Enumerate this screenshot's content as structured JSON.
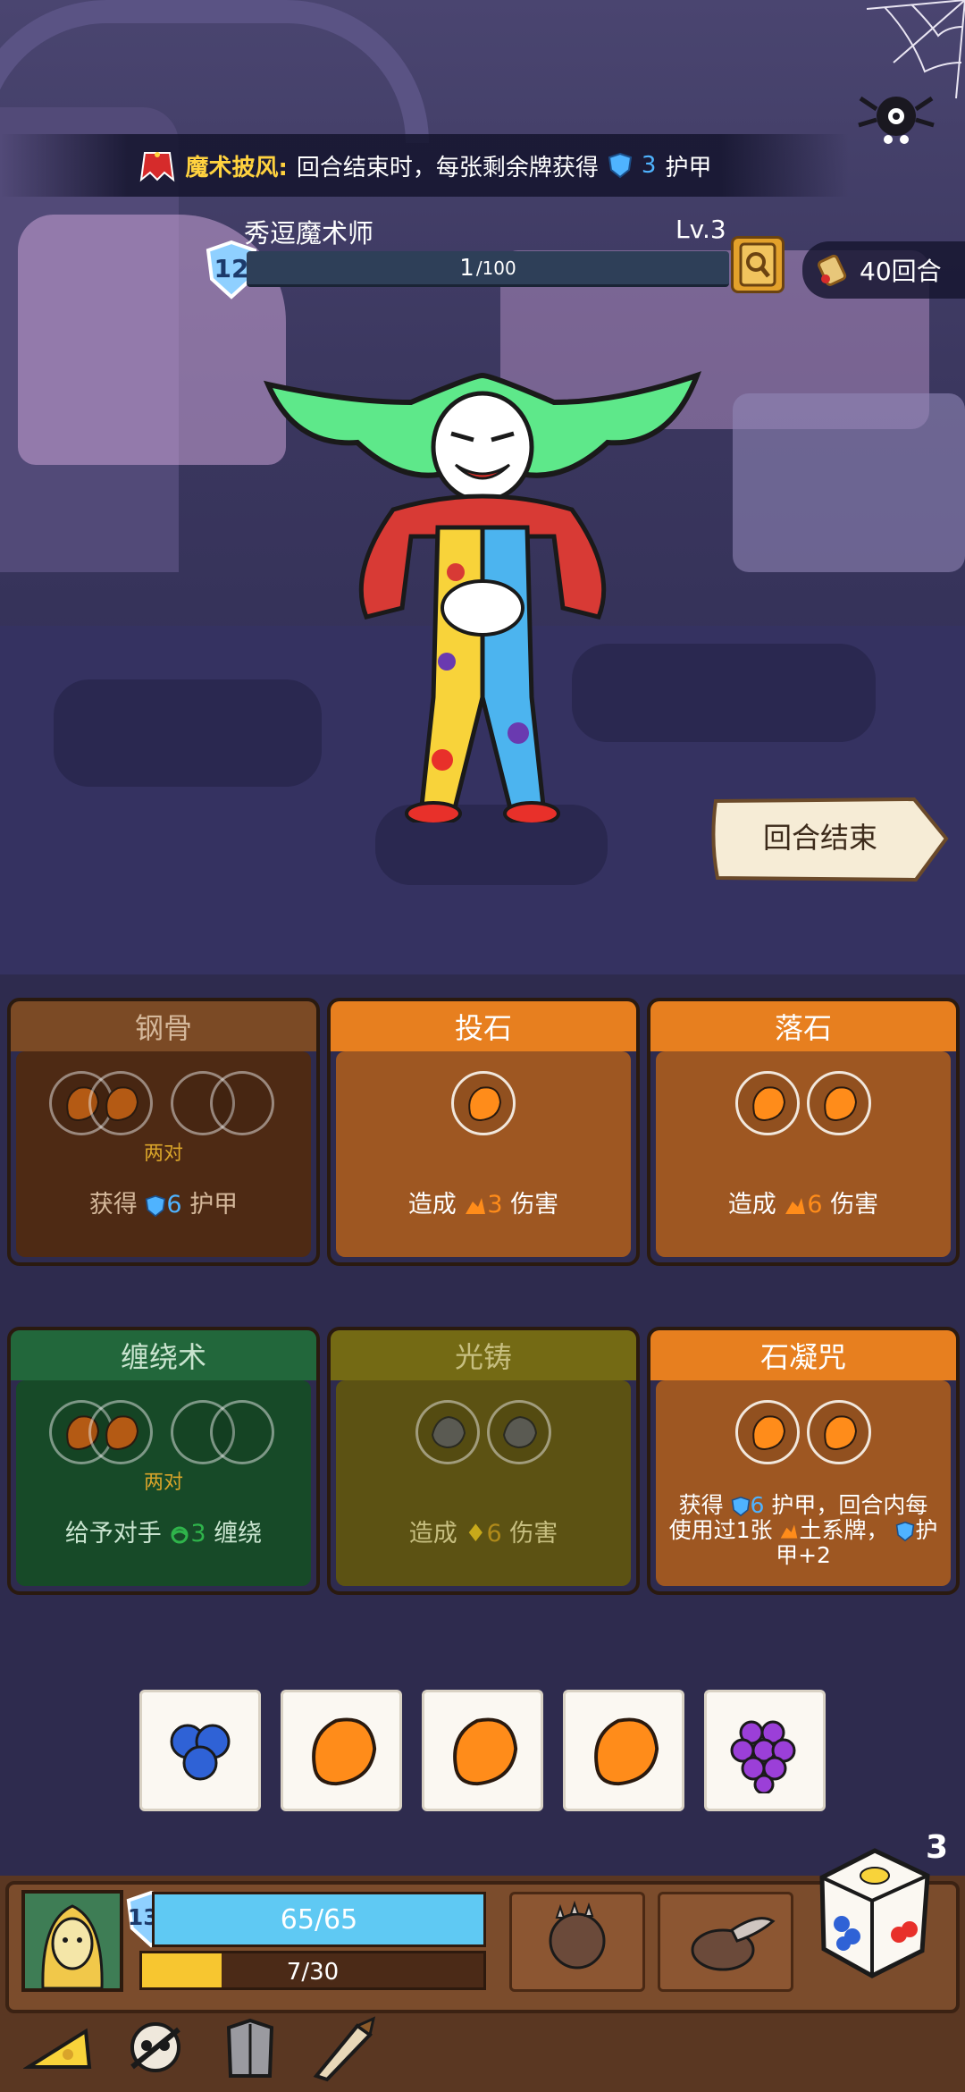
{
  "relic": {
    "name": "魔术披风:",
    "desc_before": "回合结束时，每张剩余牌获得",
    "value": "3",
    "desc_after": "护甲"
  },
  "enemy": {
    "name": "秀逗魔术师",
    "level": "Lv.3",
    "shield": "12",
    "hp_current": "1",
    "hp_max": "/100"
  },
  "round": {
    "label": "40回合"
  },
  "end_turn": {
    "label": "回合结束"
  },
  "cards": [
    {
      "title": "钢骨",
      "pair": "两对",
      "effect_prefix": "获得",
      "value": "6",
      "effect_suffix": "护甲"
    },
    {
      "title": "投石",
      "effect_prefix": "造成",
      "value": "3",
      "effect_suffix": "伤害"
    },
    {
      "title": "落石",
      "effect_prefix": "造成",
      "value": "6",
      "effect_suffix": "伤害"
    },
    {
      "title": "缠绕术",
      "pair": "两对",
      "effect_prefix": "给予对手",
      "value": "3",
      "effect_suffix": "缠绕"
    },
    {
      "title": "光铸",
      "effect_prefix": "造成",
      "value": "6",
      "effect_suffix": "伤害"
    },
    {
      "title": "石凝咒",
      "effect_line1_prefix": "获得",
      "value": "6",
      "effect_line1_suffix": "护甲，回合内每",
      "effect_line2_prefix": "使用过1张",
      "effect_line2_suffix": "土系牌，",
      "effect_line3": "护",
      "effect_line4": "甲+2"
    }
  ],
  "dice": [
    "blueberry-die",
    "orange-die",
    "orange-die",
    "orange-die",
    "grape-die"
  ],
  "player": {
    "shield": "136",
    "hp": "65/65",
    "xp": "7/30",
    "xp_fraction": 0.233
  },
  "dice_left": "3",
  "colors": {
    "orange": "#ff8c1a",
    "blue": "#4fb3ff",
    "green": "#2fb44b",
    "hp": "#5fc9f3",
    "xp": "#f7c630"
  }
}
